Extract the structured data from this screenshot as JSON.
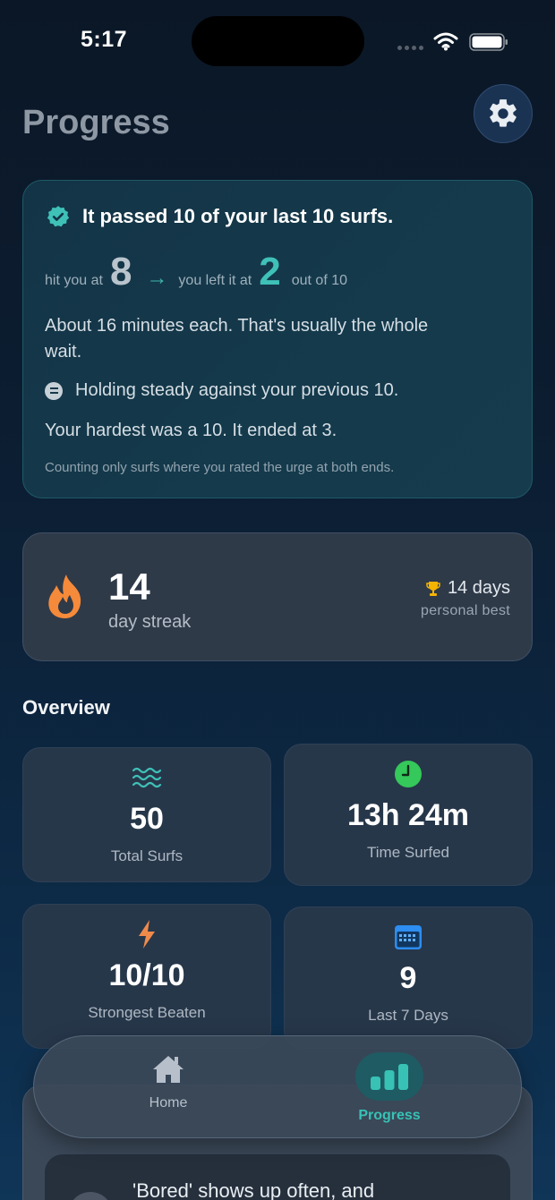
{
  "status_bar": {
    "time": "5:17"
  },
  "header": {
    "title": "Progress"
  },
  "insight": {
    "headline": "It passed 10 of your last 10 surfs.",
    "hit_prefix": "hit you at",
    "start_value": "8",
    "left_prefix": "you left it at",
    "end_value": "2",
    "out_of": "out of 10",
    "minutes_text": "About 16 minutes each. That's usually the whole wait.",
    "trend_text": "Holding steady against your previous 10.",
    "hardest_text": "Your hardest was a 10. It ended at 3.",
    "footnote": "Counting only surfs where you rated the urge at both ends."
  },
  "streak": {
    "value": "14",
    "label": "day streak",
    "best_value": "14 days",
    "best_label": "personal best"
  },
  "overview": {
    "title": "Overview",
    "cards": [
      {
        "value": "50",
        "label": "Total Surfs",
        "icon": "waves-icon"
      },
      {
        "value": "13h 24m",
        "label": "Time Surfed",
        "icon": "clock-icon"
      },
      {
        "value": "10/10",
        "label": "Strongest Beaten",
        "icon": "bolt-icon"
      },
      {
        "value": "9",
        "label": "Last 7 Days",
        "icon": "calendar-icon"
      }
    ]
  },
  "tip": {
    "text": "'Bored' shows up often, and"
  },
  "tab_bar": {
    "home_label": "Home",
    "progress_label": "Progress",
    "active": "progress"
  },
  "colors": {
    "accent": "#3fc1b8",
    "flame": "#f58a3a",
    "clock": "#35c85a",
    "bolt": "#f08a4b",
    "calendar": "#2d8df0",
    "trophy": "#f5b400"
  }
}
